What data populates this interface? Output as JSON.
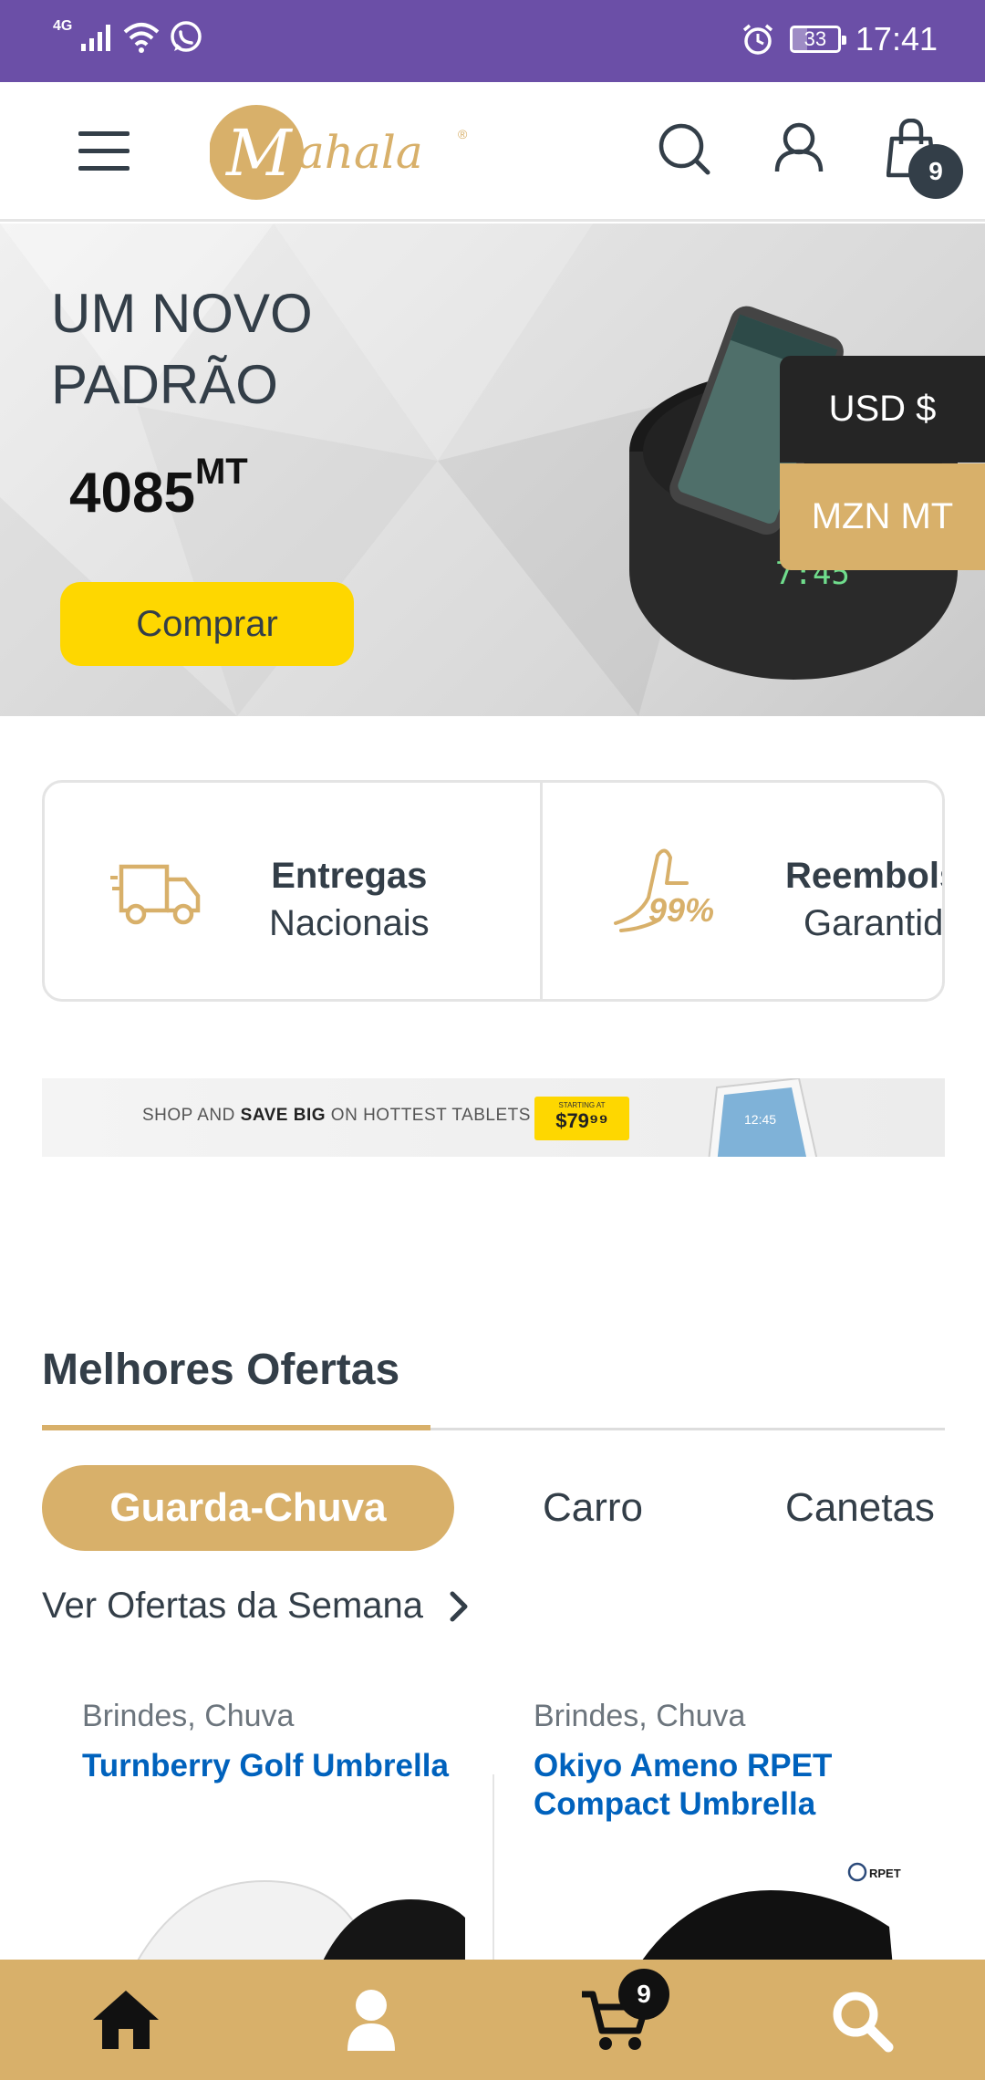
{
  "status_bar": {
    "network": "4G",
    "battery_level": "33",
    "time": "17:41",
    "icons": [
      "signal-icon",
      "wifi-icon",
      "whatsapp-icon",
      "alarm-icon",
      "battery-icon"
    ]
  },
  "header": {
    "logo_text": "Mahala",
    "logo_mark": "®",
    "cart_count": "9",
    "icons": [
      "menu-icon",
      "search-icon",
      "user-icon",
      "shopping-bag-icon"
    ]
  },
  "hero": {
    "title": "UM NOVO\nPADRÃO",
    "price": "4085",
    "currency": "MT",
    "button_label": "Comprar",
    "background_color": "#e2e2e2",
    "button_color": "#fed700"
  },
  "currency_switcher": {
    "options": [
      "USD $",
      "MZN MT"
    ]
  },
  "features": [
    {
      "title": "Entregas",
      "subtitle": "Nacionais",
      "icon": "truck-icon"
    },
    {
      "title": "Reembolso",
      "subtitle": "Garantido",
      "icon": "thumbs-up-99-icon",
      "icon_text": "99%"
    }
  ],
  "promo_banner": {
    "text_pre": "SHOP AND ",
    "text_bold": "SAVE BIG",
    "text_post": " ON HOTTEST TABLETS",
    "tag_small": "STARTING AT",
    "tag_price": "$79⁹⁹",
    "device_time": "12:45"
  },
  "deals": {
    "section_title": "Melhores Ofertas",
    "tabs": [
      {
        "label": "Guarda-Chuva",
        "active": true
      },
      {
        "label": "Carro",
        "active": false
      },
      {
        "label": "Canetas",
        "active": false
      }
    ],
    "week_link": "Ver Ofertas da Semana",
    "products": [
      {
        "categories": [
          "Brindes",
          "Chuva"
        ],
        "name": "Turnberry Golf Umbrella"
      },
      {
        "categories": [
          "Brindes",
          "Chuva"
        ],
        "name": "Okiyo Ameno RPET Compact Umbrella",
        "badge": "RPET"
      }
    ]
  },
  "bottom_nav": {
    "cart_count": "9",
    "items": [
      "home-icon",
      "user-icon",
      "cart-icon",
      "search-icon"
    ]
  },
  "colors": {
    "status_bar": "#6b4fa7",
    "brand_gold": "#d8b06a",
    "text_dark": "#333e48",
    "link_blue": "#0062bd",
    "yellow": "#fed700"
  }
}
